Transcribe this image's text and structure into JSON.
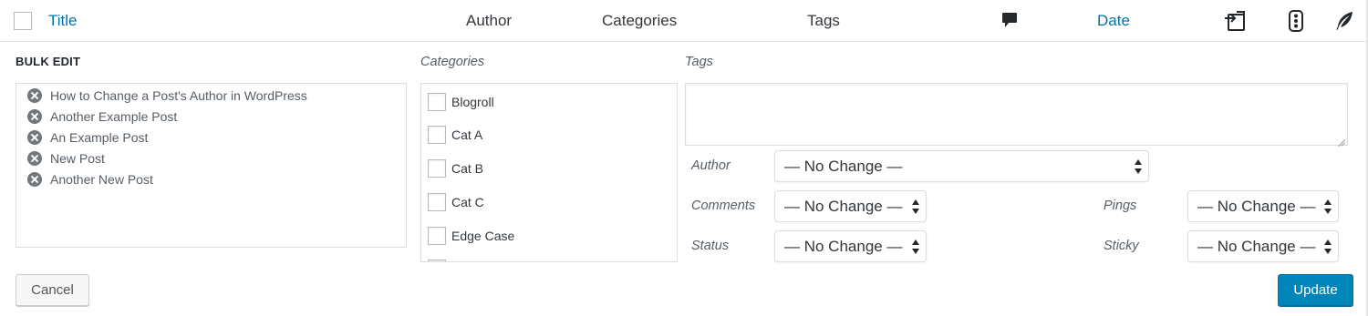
{
  "header": {
    "title": "Title",
    "author": "Author",
    "categories": "Categories",
    "tags": "Tags",
    "date": "Date",
    "icons": [
      "comment-icon",
      "export-icon",
      "traffic-light-icon",
      "feather-icon"
    ]
  },
  "bulk_edit": {
    "heading": "BULK EDIT",
    "posts": [
      "How to Change a Post's Author in WordPress",
      "Another Example Post",
      "An Example Post",
      "New Post",
      "Another New Post"
    ],
    "categories_label": "Categories",
    "categories": [
      "Blogroll",
      "Cat A",
      "Cat B",
      "Cat C",
      "Edge Case"
    ],
    "tags_label": "Tags",
    "tags_value": "",
    "fields": {
      "author": {
        "label": "Author",
        "value": "— No Change —"
      },
      "comments": {
        "label": "Comments",
        "value": "— No Change —"
      },
      "status": {
        "label": "Status",
        "value": "— No Change —"
      },
      "pings": {
        "label": "Pings",
        "value": "— No Change —"
      },
      "sticky": {
        "label": "Sticky",
        "value": "— No Change —"
      }
    },
    "cancel_label": "Cancel",
    "update_label": "Update"
  },
  "colors": {
    "link": "#0073aa",
    "primary_button": "#0085ba",
    "border": "#dddddd"
  }
}
